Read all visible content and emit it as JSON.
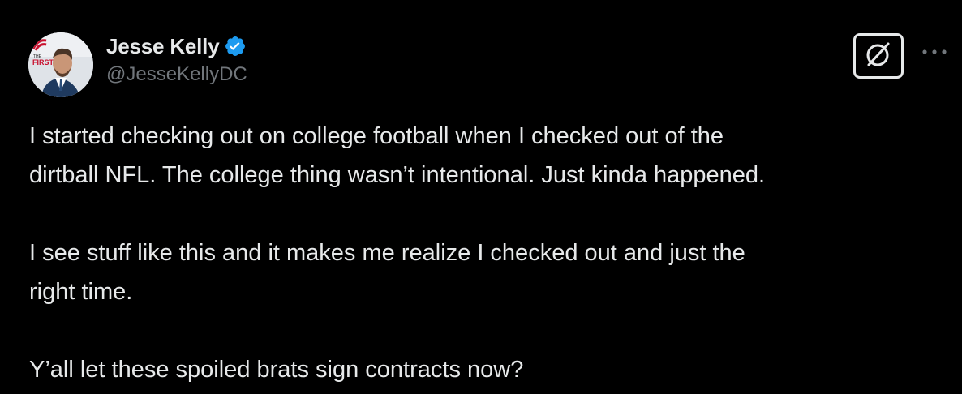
{
  "tweet": {
    "author": {
      "display_name": "Jesse Kelly",
      "handle": "@JesseKellyDC",
      "avatar_badge_top": "THE",
      "avatar_badge_main": "FIRST"
    },
    "paragraphs": [
      "I started checking out on college football when I checked out of the\ndirtball NFL. The college thing wasn’t intentional. Just kinda happened.",
      "I see stuff like this and it makes me realize I checked out and just the\nright time.",
      "Y’all let these spoiled brats sign contracts now?"
    ]
  },
  "icons": {
    "verified": "verified-badge-icon",
    "grok": "grok-slash-circle-icon",
    "more": "more-dots-icon"
  },
  "colors": {
    "background": "#000000",
    "text_primary": "#e7e9ea",
    "text_secondary": "#71767b",
    "verified_blue": "#1d9bf0"
  }
}
